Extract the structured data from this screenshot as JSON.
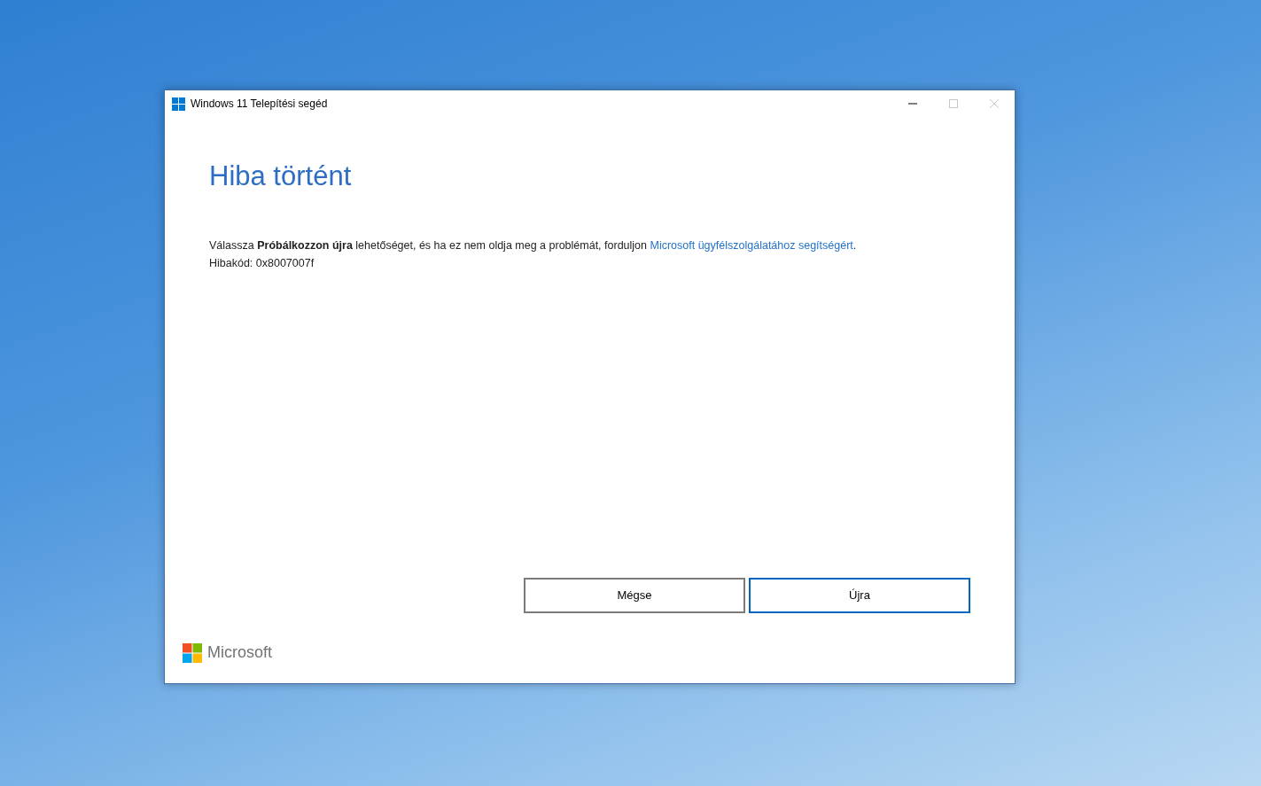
{
  "window": {
    "title": "Windows 11 Telepítési segéd"
  },
  "window_controls": [
    {
      "kind": "minimize",
      "disabled": false
    },
    {
      "kind": "maximize",
      "disabled": true
    },
    {
      "kind": "close",
      "disabled": true
    }
  ],
  "heading": "Hiba történt",
  "message": {
    "text": "Válassza **Próbálkozzon újra** lehetőséget, és ha ez nem oldja meg a problémát, forduljon ",
    "link": "Microsoft ügyfélszolgálatához segítségért",
    "after": "."
  },
  "error_code": "Hibakód: 0x8007007f",
  "buttons": [
    {
      "label": "Mégse",
      "default": false
    },
    {
      "label": "Újra",
      "default": true
    }
  ],
  "footer": {
    "brand": "Microsoft"
  }
}
